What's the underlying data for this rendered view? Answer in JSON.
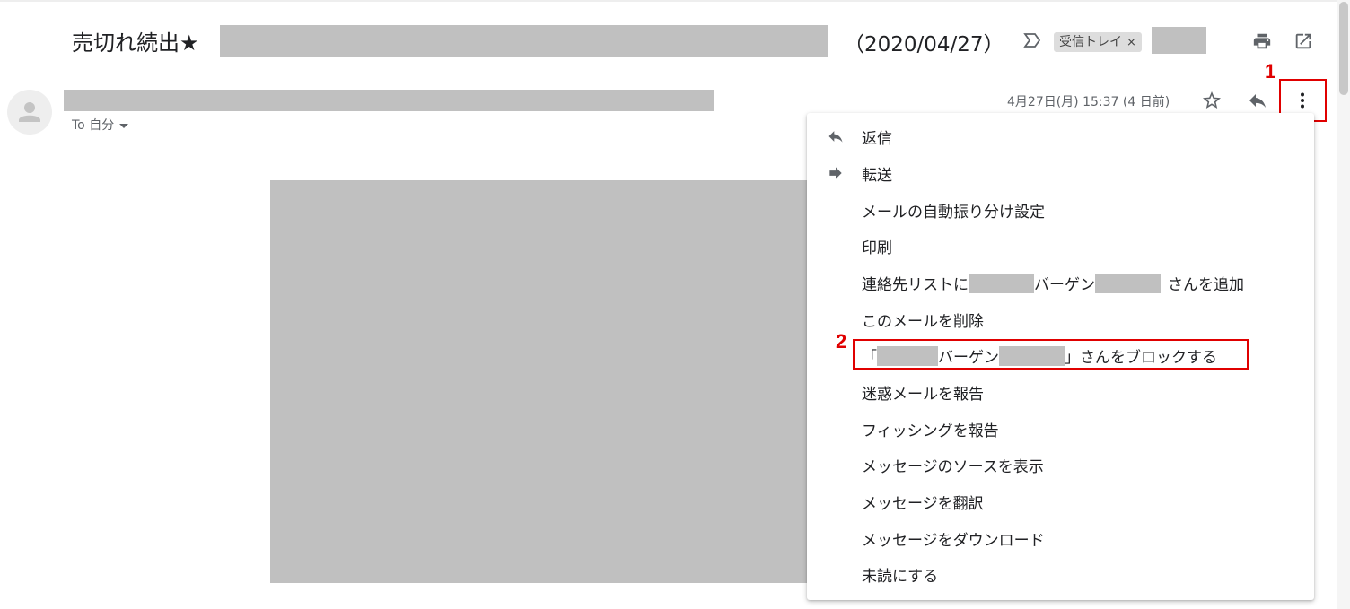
{
  "email": {
    "subject_prefix": "売切れ続出★",
    "subject_date": "（2020/04/27）",
    "label_chip": "受信トレイ",
    "label_chip_remove": "×",
    "recipient": "To 自分",
    "timestamp": "4月27日(月) 15:37 (4 日前)"
  },
  "icons": {
    "importance": "importance-marker-icon",
    "print": "print-icon",
    "open_new_window": "open-in-new-window-icon",
    "star": "star-icon",
    "reply": "reply-icon",
    "more": "more-vert-icon",
    "avatar": "default-avatar-icon",
    "forward": "forward-icon"
  },
  "annotations": {
    "step1": "1",
    "step2": "2"
  },
  "menu": {
    "reply": "返信",
    "forward": "転送",
    "filter": "メールの自動振り分け設定",
    "print": "印刷",
    "add_contact_prefix": "連絡先リストに",
    "add_contact_middle": "バーゲン",
    "add_contact_suffix": "さんを追加",
    "delete": "このメールを削除",
    "block_open": "「",
    "block_middle": "バーゲン",
    "block_suffix": "」さんをブロックする",
    "report_spam": "迷惑メールを報告",
    "report_phishing": "フィッシングを報告",
    "show_original": "メッセージのソースを表示",
    "translate": "メッセージを翻訳",
    "download": "メッセージをダウンロード",
    "mark_unread": "未読にする"
  },
  "colors": {
    "annotation": "#e00000",
    "redaction": "#c0c0c0",
    "icon": "#5f6368"
  }
}
